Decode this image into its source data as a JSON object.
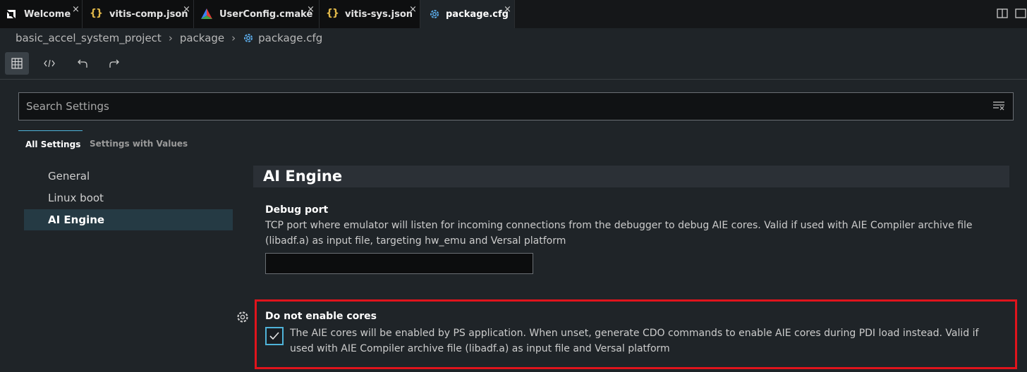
{
  "tabs": [
    {
      "label": "Welcome",
      "icon": "amd-logo-icon",
      "active": false
    },
    {
      "label": "vitis-comp.json",
      "icon": "json-braces-icon",
      "active": false
    },
    {
      "label": "UserConfig.cmake",
      "icon": "cmake-triangle-icon",
      "active": false
    },
    {
      "label": "vitis-sys.json",
      "icon": "json-braces-icon",
      "active": false
    },
    {
      "label": "package.cfg",
      "icon": "gear-icon",
      "active": true
    }
  ],
  "close_glyph": "×",
  "braces_glyph": "{}",
  "breadcrumb": {
    "project": "basic_accel_system_project",
    "folder": "package",
    "file": "package.cfg",
    "separator": "›"
  },
  "search": {
    "placeholder": "Search Settings"
  },
  "settings_tabs": {
    "all": "All Settings",
    "with_values": "Settings with Values"
  },
  "nav": {
    "items": [
      {
        "label": "General"
      },
      {
        "label": "Linux boot"
      },
      {
        "label": "AI Engine"
      }
    ]
  },
  "section": {
    "title": "AI Engine"
  },
  "debug_port": {
    "title": "Debug port",
    "desc_line1": "TCP port where emulator will listen for incoming connections from the debugger to debug AIE cores. Valid if used with AIE Compiler archive file",
    "desc_line2": "(libadf.a) as input file, targeting hw_emu and Versal platform",
    "value": ""
  },
  "do_not_enable": {
    "title": "Do not enable cores",
    "desc_line1": "The AIE cores will be enabled by PS application. When unset, generate CDO commands to enable AIE cores during PDI load instead. Valid if",
    "desc_line2": "used with AIE Compiler archive file (libadf.a) as input file and Versal platform",
    "checked": true
  },
  "colors": {
    "accent": "#4fb3d9",
    "highlight": "#e0141c"
  }
}
